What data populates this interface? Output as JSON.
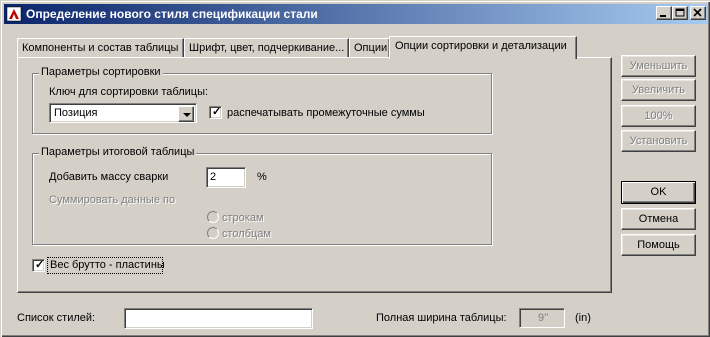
{
  "window": {
    "title": "Определение нового стиля спецификации стали"
  },
  "tabs": [
    {
      "label": "Компоненты и состав таблицы",
      "active": false
    },
    {
      "label": "Шрифт, цвет, подчеркивание...",
      "active": false
    },
    {
      "label": "Опции",
      "active": false
    },
    {
      "label": "Опции сортировки и детализации",
      "active": true
    }
  ],
  "sort_group": {
    "title": "Параметры сортировки",
    "key_label": "Ключ для сортировки таблицы:",
    "key_value": "Позиция",
    "subtotals_label": "распечатывать промежуточные суммы",
    "subtotals_checked": true
  },
  "summary_group": {
    "title": "Параметры итоговой таблицы",
    "weld_label": "Добавить массу сварки",
    "weld_value": "2",
    "weld_unit": "%",
    "sum_label": "Суммировать данные по",
    "radio_rows": "строкам",
    "radio_cols": "столбцам"
  },
  "gross_weight": {
    "label": "Вес брутто - пластины",
    "checked": true
  },
  "side_buttons": {
    "decrease": "Уменьшить",
    "increase": "Увеличить",
    "percent": "100%",
    "set": "Установить",
    "ok": "OK",
    "cancel": "Отмена",
    "help": "Помощь"
  },
  "footer": {
    "styles_label": "Список стилей:",
    "styles_value": "",
    "width_label": "Полная ширина таблицы:",
    "width_value": "9''",
    "width_unit": "(in)"
  },
  "colors": {
    "face": "#d4d0c8",
    "title_start": "#0a246a",
    "title_end": "#a6caf0"
  }
}
